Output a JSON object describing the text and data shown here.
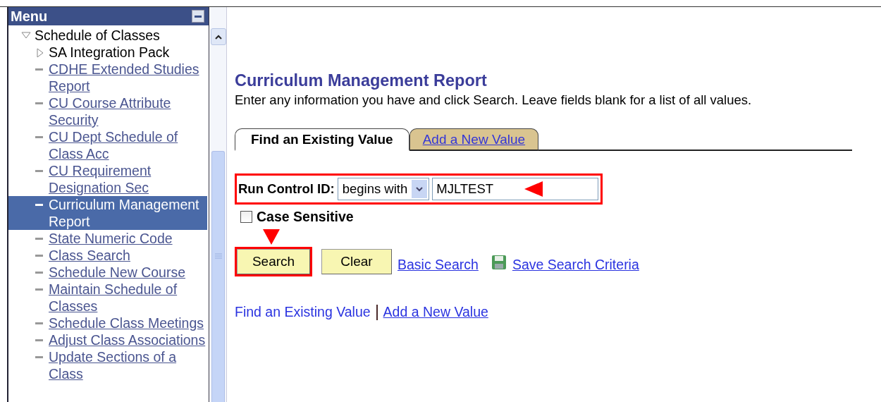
{
  "menu": {
    "title": "Menu",
    "tree": [
      {
        "label": "Schedule of Classes",
        "kind": "folder",
        "expanded": true,
        "children": [
          {
            "label": "SA Integration Pack",
            "kind": "folder",
            "expanded": false,
            "selected": false
          },
          {
            "label": "CDHE Extended Studies Report",
            "kind": "link",
            "selected": false
          },
          {
            "label": "CU Course Attribute Security",
            "kind": "link",
            "selected": false
          },
          {
            "label": "CU Dept Schedule of Class Acc",
            "kind": "link",
            "selected": false
          },
          {
            "label": "CU Requirement Designation Sec",
            "kind": "link",
            "selected": false
          },
          {
            "label": "Curriculum Management Report",
            "kind": "link",
            "selected": true
          },
          {
            "label": "State Numeric Code",
            "kind": "link",
            "selected": false
          },
          {
            "label": "Class Search",
            "kind": "link",
            "selected": false
          },
          {
            "label": "Schedule New Course",
            "kind": "link",
            "selected": false
          },
          {
            "label": "Maintain Schedule of Classes",
            "kind": "link",
            "selected": false
          },
          {
            "label": "Schedule Class Meetings",
            "kind": "link",
            "selected": false
          },
          {
            "label": "Adjust Class Associations",
            "kind": "link",
            "selected": false
          },
          {
            "label": "Update Sections of a Class",
            "kind": "link",
            "selected": false
          }
        ]
      }
    ]
  },
  "page": {
    "title": "Curriculum Management Report",
    "instructions": "Enter any information you have and click Search. Leave fields blank for a list of all values.",
    "tabs": [
      {
        "label": "Find an Existing Value",
        "selected": true
      },
      {
        "label": "Add a New Value",
        "selected": false
      }
    ],
    "run_control": {
      "label": "Run Control ID:",
      "operator": "begins with",
      "value": "MJLTEST",
      "highlighted": true
    },
    "case_sensitive": {
      "label": "Case Sensitive",
      "checked": false
    },
    "buttons": [
      {
        "label": "Search",
        "highlighted": true
      },
      {
        "label": "Clear",
        "highlighted": false
      }
    ],
    "links": [
      {
        "label": "Basic Search",
        "kind": "link"
      },
      {
        "label": "Save Search Criteria",
        "kind": "save"
      }
    ],
    "footer_links": [
      {
        "label": "Find an Existing Value",
        "underlined": false
      },
      {
        "label": "Add a New Value",
        "underlined": true
      }
    ]
  }
}
